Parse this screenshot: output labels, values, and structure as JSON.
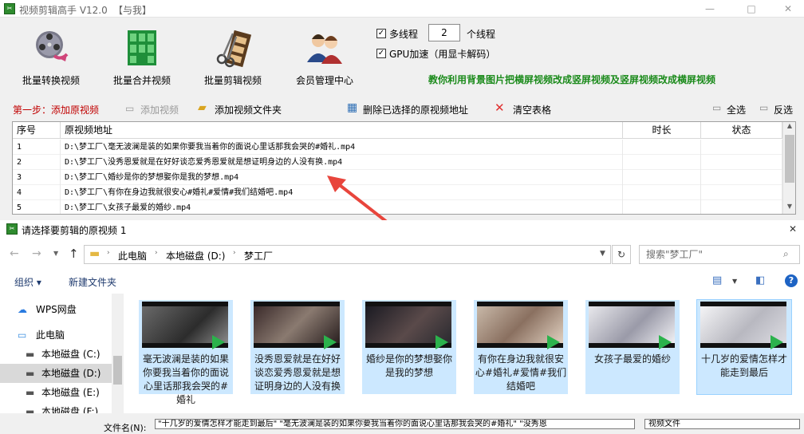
{
  "window": {
    "title": "视频剪辑高手 V12.0",
    "tag": "【与我】",
    "min": "—",
    "max": "□",
    "close": "✕"
  },
  "toolbar": {
    "items": [
      {
        "label": "批量转换视频",
        "icon": "film-reel-icon"
      },
      {
        "label": "批量合并视频",
        "icon": "merge-grid-icon"
      },
      {
        "label": "批量剪辑视频",
        "icon": "scissors-film-icon"
      },
      {
        "label": "会员管理中心",
        "icon": "members-icon"
      }
    ]
  },
  "options": {
    "multithread_label": "多线程",
    "thread_count": "2",
    "thread_unit": "个线程",
    "gpu_label": "GPU加速（用显卡解码）",
    "promo": "教你利用背景图片把横屏视频改成竖屏视频及竖屏视频改成横屏视频"
  },
  "actions": {
    "step1": "第一步：添加原视频",
    "add_video": "添加视频",
    "add_folder": "添加视频文件夹",
    "delete_selected": "删除已选择的原视频地址",
    "clear_table": "清空表格",
    "select_all": "全选",
    "invert": "反选"
  },
  "table": {
    "headers": [
      "序号",
      "原视频地址",
      "时长",
      "状态"
    ],
    "rows": [
      {
        "no": "1",
        "path": "D:\\梦工厂\\毫无波澜是装的如果你要我当着你的面说心里话那我会哭的#婚礼.mp4",
        "dur": "",
        "status": ""
      },
      {
        "no": "2",
        "path": "D:\\梦工厂\\没秀恩爱就是在好好谈恋爱秀恩爱就是想证明身边的人没有换.mp4",
        "dur": "",
        "status": ""
      },
      {
        "no": "3",
        "path": "D:\\梦工厂\\婚纱是你的梦想娶你是我的梦想.mp4",
        "dur": "",
        "status": ""
      },
      {
        "no": "4",
        "path": "D:\\梦工厂\\有你在身边我就很安心#婚礼#爱情#我们结婚吧.mp4",
        "dur": "",
        "status": ""
      },
      {
        "no": "5",
        "path": "D:\\梦工厂\\女孩子最爱的婚纱.mp4",
        "dur": "",
        "status": ""
      }
    ]
  },
  "dialog": {
    "title": "请选择要剪辑的原视频 1",
    "crumbs": [
      "此电脑",
      "本地磁盘 (D:)",
      "梦工厂"
    ],
    "search_placeholder": "搜索\"梦工厂\"",
    "organize": "组织 ▾",
    "new_folder": "新建文件夹",
    "nav": [
      {
        "label": "WPS网盘",
        "icon": "cloud-icon"
      },
      {
        "label": "此电脑",
        "icon": "computer-icon"
      },
      {
        "label": "本地磁盘 (C:)",
        "icon": "drive-icon"
      },
      {
        "label": "本地磁盘 (D:)",
        "icon": "drive-icon"
      },
      {
        "label": "本地磁盘 (E:)",
        "icon": "drive-icon"
      },
      {
        "label": "本地磁盘 (F:)",
        "icon": "drive-icon"
      }
    ],
    "files": [
      {
        "name": "毫无波澜是装的如果你要我当着你的面说心里话那我会哭的#婚礼"
      },
      {
        "name": "没秀恩爱就是在好好谈恋爱秀恩爱就是想证明身边的人没有换"
      },
      {
        "name": "婚纱是你的梦想娶你是我的梦想"
      },
      {
        "name": "有你在身边我就很安心#婚礼#爱情#我们结婚吧"
      },
      {
        "name": "女孩子最爱的婚纱"
      },
      {
        "name": "十几岁的爱情怎样才能走到最后"
      }
    ],
    "filename_label": "文件名(N):",
    "filename_value": "\"十几岁的爱情怎样才能走到最后\" \"毫无波澜是装的如果你要我当着你的面说心里话那我会哭的#婚礼\" \"没秀恩",
    "filetype": "视频文件"
  },
  "colors": {
    "promo": "#1a8a1a",
    "step1": "#c00000",
    "selection": "#cce8ff",
    "arrow": "#e8453c"
  }
}
